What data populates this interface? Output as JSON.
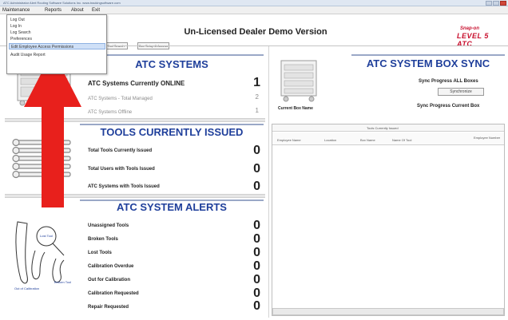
{
  "window": {
    "title": "ATC Administrator Alert Routing Software Solutions Inc.   www.trackingsoftware.com"
  },
  "menubar": {
    "items": [
      "Maintenance",
      "Reports",
      "About",
      "Exit"
    ]
  },
  "maintenance_menu": {
    "items": [
      "Log Out",
      "Log In",
      "Log Search",
      "Preferences",
      "Edit Employee Access Permissions",
      "Audit Usage Report"
    ],
    "selected_index": 4
  },
  "header": {
    "title": "Un-Licensed Dealer Demo Version",
    "buttons": [
      "Tool Search",
      "Box Setup & Access"
    ],
    "logo_top": "Snap-on",
    "logo_main": "LEVEL 5 ATC"
  },
  "atc_systems": {
    "title": "ATC SYSTEMS",
    "rows": [
      {
        "label": "ATC Systems Currently ONLINE",
        "value": "1"
      },
      {
        "label": "ATC Systems - Total Managed",
        "value": "2"
      },
      {
        "label": "ATC Systems Offline",
        "value": "1"
      }
    ]
  },
  "tools_issued": {
    "title": "TOOLS CURRENTLY ISSUED",
    "rows": [
      {
        "label": "Total Tools Currently Issued",
        "value": "0"
      },
      {
        "label": "Total Users with Tools Issued",
        "value": "0"
      },
      {
        "label": "ATC Systems with Tools Issued",
        "value": "0"
      }
    ]
  },
  "alerts": {
    "title": "ATC SYSTEM ALERTS",
    "rows": [
      {
        "label": "Unassigned Tools",
        "value": "0"
      },
      {
        "label": "Broken Tools",
        "value": "0"
      },
      {
        "label": "Lost Tools",
        "value": "0"
      },
      {
        "label": "Calibration Overdue",
        "value": "0"
      },
      {
        "label": "Out for Calibration",
        "value": "0"
      },
      {
        "label": "Calibration Requested",
        "value": "0"
      },
      {
        "label": "Repair Requested",
        "value": "0"
      }
    ],
    "illustration_labels": [
      "Lost Tool",
      "Broken Tool",
      "Out of Calibration"
    ]
  },
  "box_sync": {
    "title": "ATC SYSTEM BOX SYNC",
    "sync_all_label": "Sync Progress ALL Boxes",
    "sync_button": "Synchronize",
    "sync_current_label": "Sync Progress Current Box",
    "current_box_label": "Current Box Name"
  },
  "issued_table": {
    "caption": "Tools Currently Issued",
    "columns": [
      "Employee Name",
      "Location",
      "Box Name",
      "Name Of Tool",
      "Employee Number"
    ]
  },
  "colors": {
    "section_title": "#1f3f9b",
    "arrow": "#e8201c",
    "logo": "#c8102e"
  }
}
